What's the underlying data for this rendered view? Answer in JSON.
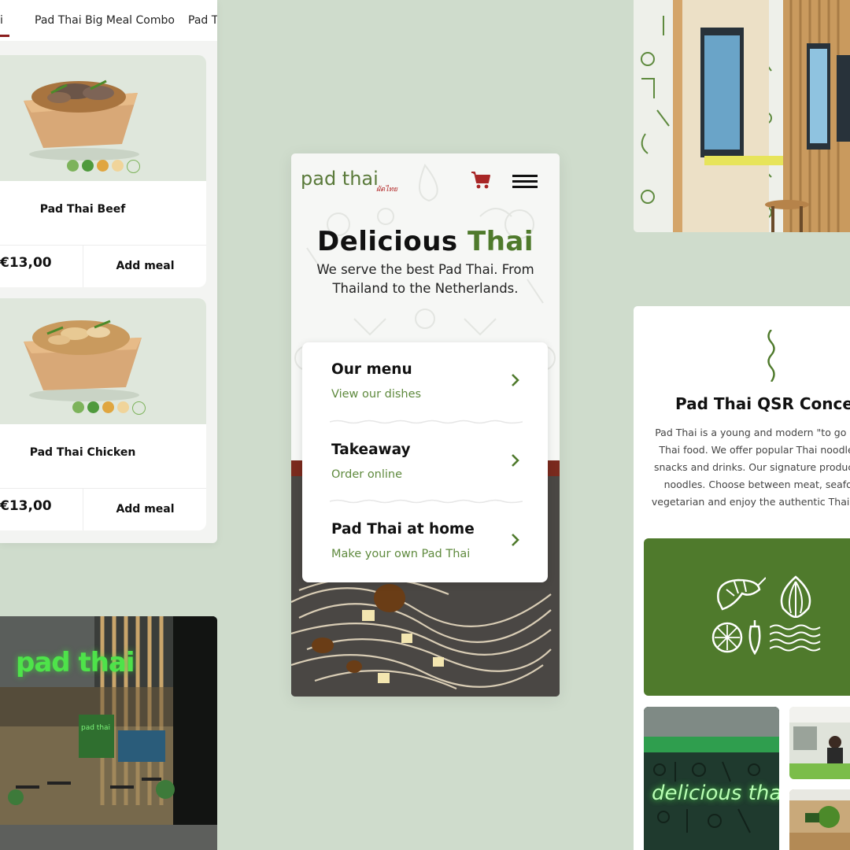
{
  "listing": {
    "tabs": [
      "i",
      "Pad Thai Big Meal Combo",
      "Pad Th"
    ],
    "products": [
      {
        "name": "Pad Thai Beef",
        "price": "€13,00",
        "action": "Add meal"
      },
      {
        "name": "Pad Thai Chicken",
        "price": "€13,00",
        "action": "Add meal"
      }
    ]
  },
  "store": {
    "sign": "pad thai",
    "inner_sign": "pad thai"
  },
  "phone": {
    "logo": "pad thai",
    "logo_sub": "ผัดไทย",
    "hero_title_main": "Delicious",
    "hero_title_accent": "Thai",
    "hero_subtitle": "We serve the best Pad Thai. From Thailand to the Netherlands.",
    "menu": [
      {
        "title": "Our menu",
        "subtitle": "View our dishes"
      },
      {
        "title": "Takeaway",
        "subtitle": "Order online"
      },
      {
        "title": "Pad Thai at home",
        "subtitle": "Make your own Pad Thai"
      }
    ]
  },
  "concept": {
    "title": "Pad Thai QSR Concep",
    "lines": [
      "Pad Thai is a young and modern \"to go con",
      "Thai food. We offer popular Thai noodle d",
      "snacks and drinks. Our signature product is",
      "noodles. Choose between meat, seafoo",
      "vegetarian and enjoy the authentic Thai exp"
    ],
    "neon": "delicious thai"
  },
  "colors": {
    "background": "#cfdccc",
    "brand_green": "#4f7a2c",
    "brand_red": "#b02323",
    "neon_green": "#4ee34a"
  },
  "icons": [
    "cart-icon",
    "hamburger-menu-icon",
    "chevron-right-icon",
    "shrimp-icon",
    "onion-icon",
    "lime-icon",
    "chili-icon",
    "water-waves-icon",
    "squiggle-noodle-icon"
  ]
}
